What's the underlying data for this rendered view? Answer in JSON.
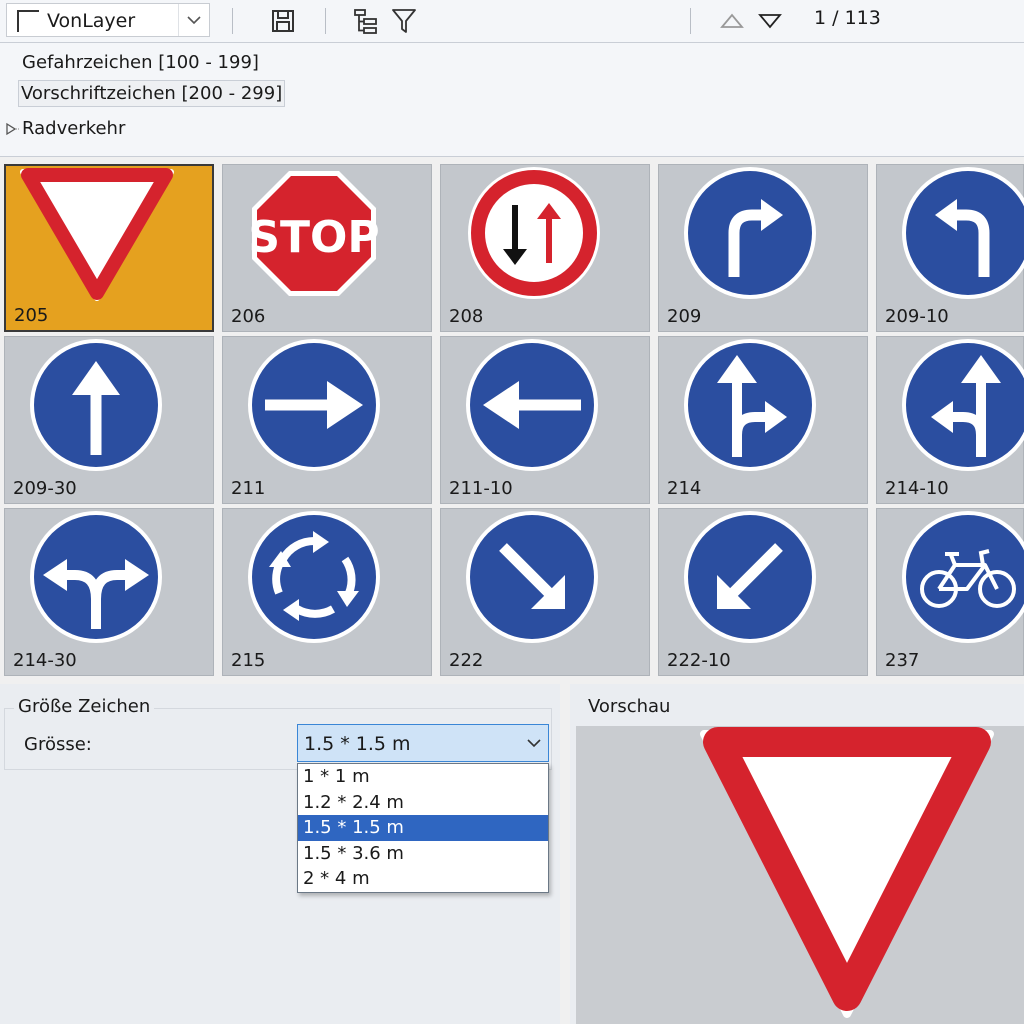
{
  "toolbar": {
    "layer": "VonLayer",
    "pager": "1 / 113"
  },
  "tree": {
    "items": [
      {
        "label": "Gefahrzeichen [100 - 199]"
      },
      {
        "label": "Vorschriftzeichen [200 - 299]"
      },
      {
        "label": "Radverkehr"
      }
    ]
  },
  "signs": [
    {
      "code": "205"
    },
    {
      "code": "206"
    },
    {
      "code": "208"
    },
    {
      "code": "209"
    },
    {
      "code": "209-10"
    },
    {
      "code": "209-30"
    },
    {
      "code": "211"
    },
    {
      "code": "211-10"
    },
    {
      "code": "214"
    },
    {
      "code": "214-10"
    },
    {
      "code": "214-30"
    },
    {
      "code": "215"
    },
    {
      "code": "222"
    },
    {
      "code": "222-10"
    },
    {
      "code": "237"
    }
  ],
  "stop_text": "STOP",
  "size": {
    "group_title": "Größe Zeichen",
    "label": "Grösse:",
    "selected": "1.5 * 1.5 m",
    "options": [
      "1 * 1 m",
      "1.2 * 2.4 m",
      "1.5 * 1.5 m",
      "1.5 * 3.6 m",
      "2 * 4 m"
    ]
  },
  "preview": {
    "title": "Vorschau"
  },
  "colors": {
    "sign_blue": "#2b4ea0",
    "sign_red": "#d5232d",
    "selection_orange": "#e5a11f",
    "dropdown_selected": "#2f66c1"
  }
}
